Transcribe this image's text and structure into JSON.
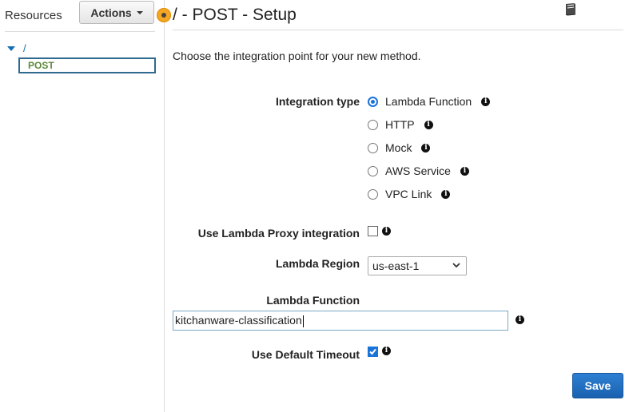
{
  "sidebar": {
    "title": "Resources",
    "actions_label": "Actions",
    "tree": {
      "root_label": "/",
      "method_label": "POST"
    }
  },
  "main": {
    "title": "/ - POST - Setup",
    "intro": "Choose the integration point for your new method.",
    "integration_type": {
      "label": "Integration type",
      "options": [
        {
          "label": "Lambda Function",
          "checked": true
        },
        {
          "label": "HTTP",
          "checked": false
        },
        {
          "label": "Mock",
          "checked": false
        },
        {
          "label": "AWS Service",
          "checked": false
        },
        {
          "label": "VPC Link",
          "checked": false
        }
      ]
    },
    "proxy": {
      "label": "Use Lambda Proxy integration",
      "checked": false
    },
    "region": {
      "label": "Lambda Region",
      "value": "us-east-1"
    },
    "function": {
      "label": "Lambda Function",
      "value": "kitchanware-classification"
    },
    "timeout": {
      "label": "Use Default Timeout",
      "checked": true
    },
    "save_label": "Save"
  },
  "icons": {
    "info": "info-icon",
    "book": "book-icon",
    "splitter": "splitter-handle-icon"
  },
  "colors": {
    "accent": "#1a73d9",
    "save_button": "#1b62b0",
    "splitter": "#f5a623",
    "tree_link": "#146eb4",
    "tree_method": "#5d8a3a"
  }
}
